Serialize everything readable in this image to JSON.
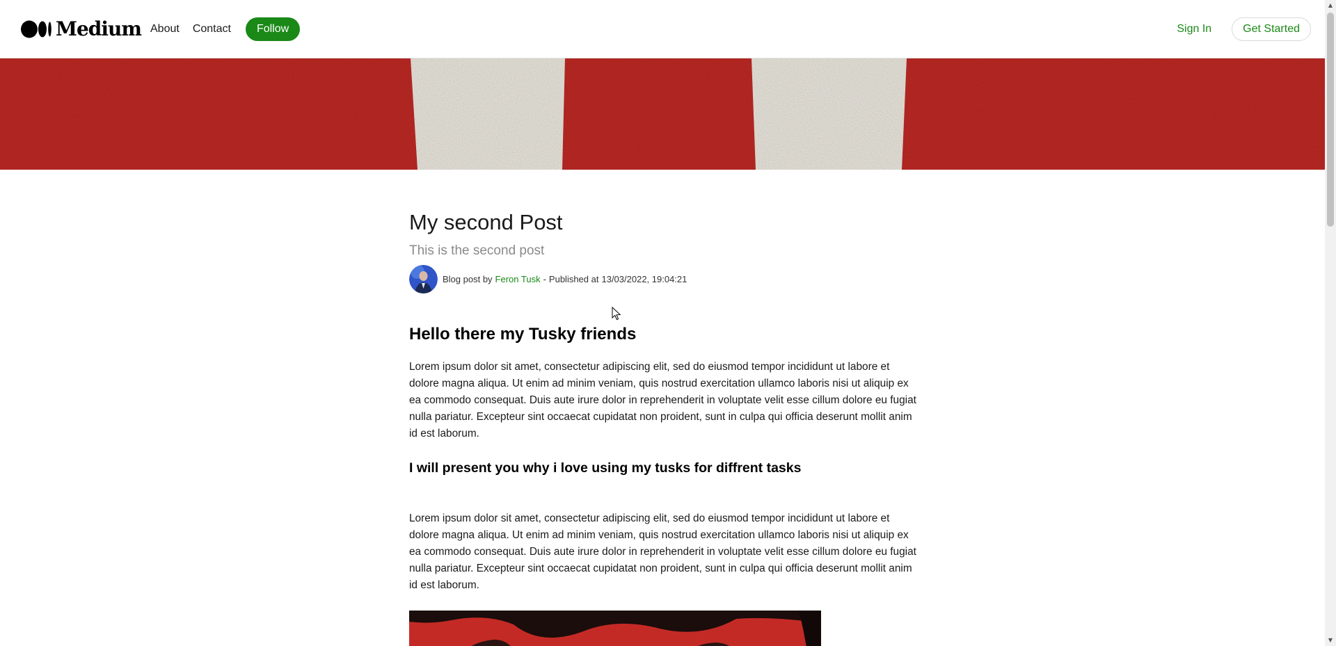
{
  "navbar": {
    "brand": "Medium",
    "links": [
      "About",
      "Contact"
    ],
    "follow_label": "Follow",
    "sign_in_label": "Sign In",
    "get_started_label": "Get Started"
  },
  "article": {
    "title": "My second Post",
    "subtitle": "This is the second post",
    "byline": {
      "prefix": "Blog post by",
      "author": "Feron Tusk",
      "separator": "-",
      "published_label": "Published at",
      "date": "13/03/2022, 19:04:21"
    },
    "heading_main": "Hello there my Tusky friends",
    "paragraph_1": "Lorem ipsum dolor sit amet, consectetur adipiscing elit, sed do eiusmod tempor incididunt ut labore et dolore magna aliqua. Ut enim ad minim veniam, quis nostrud exercitation ullamco laboris nisi ut aliquip ex ea commodo consequat. Duis aute irure dolor in reprehenderit in voluptate velit esse cillum dolore eu fugiat nulla pariatur. Excepteur sint occaecat cupidatat non proident, sunt in culpa qui officia deserunt mollit anim id est laborum.",
    "heading_sub": "I will present you why i love using my tusks for diffrent tasks",
    "paragraph_2": "Lorem ipsum dolor sit amet, consectetur adipiscing elit, sed do eiusmod tempor incididunt ut labore et dolore magna aliqua. Ut enim ad minim veniam, quis nostrud exercitation ullamco laboris nisi ut aliquip ex ea commodo consequat. Duis aute irure dolor in reprehenderit in voluptate velit esse cillum dolore eu fugiat nulla pariatur. Excepteur sint occaecat cupidatat non proident, sunt in culpa qui officia deserunt mollit anim id est laborum."
  },
  "colors": {
    "accent_green": "#1a8917",
    "hero_red": "#c42a25",
    "hero_cream": "#f3efe6"
  },
  "icons": {
    "brand": "medium-logo-icon",
    "scroll_up": "arrow-up-icon",
    "scroll_down": "arrow-down-icon",
    "cursor": "mouse-pointer-icon"
  }
}
